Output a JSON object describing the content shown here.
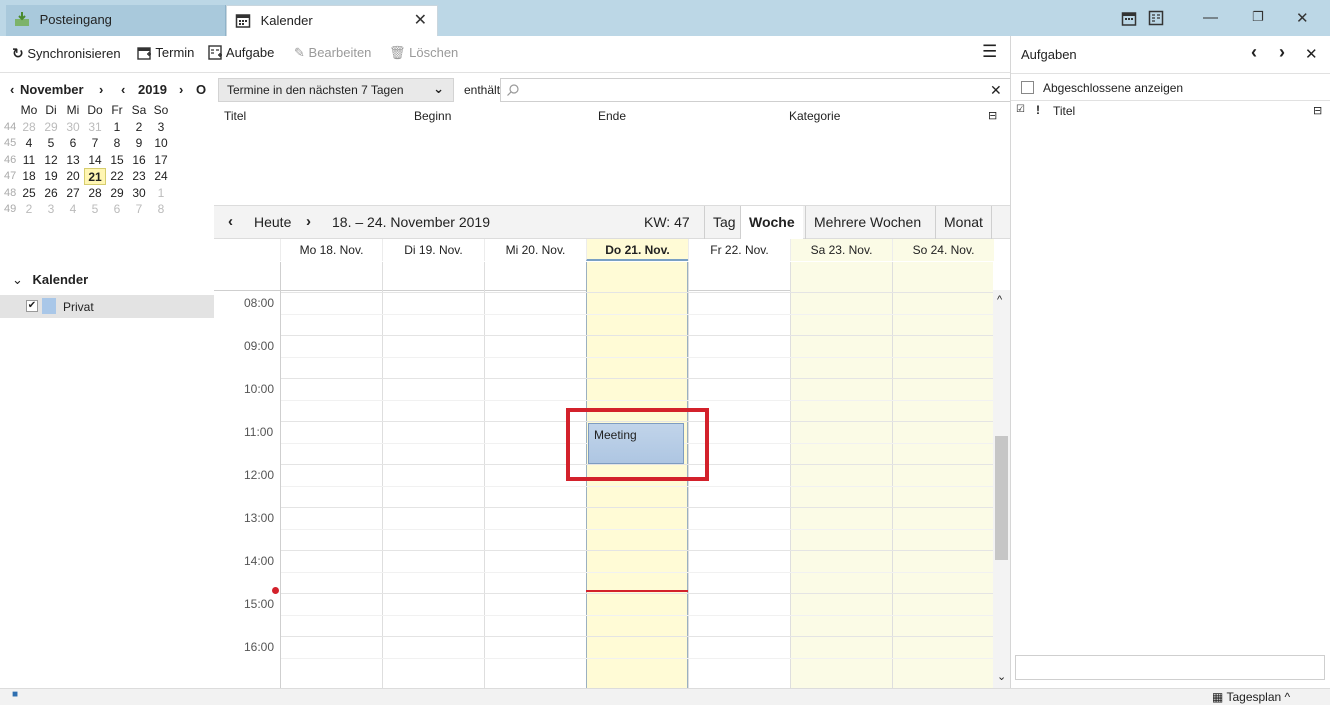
{
  "tabs": {
    "inbox": "Posteingang",
    "calendar": "Kalender"
  },
  "toolbar": {
    "sync": "Synchronisieren",
    "event": "Termin",
    "task": "Aufgabe",
    "edit": "Bearbeiten",
    "delete": "Löschen"
  },
  "minical": {
    "month": "November",
    "year": "2019",
    "weekdays": [
      "Mo",
      "Di",
      "Mi",
      "Do",
      "Fr",
      "Sa",
      "So"
    ],
    "weeks": [
      {
        "wk": "44",
        "days": [
          "28",
          "29",
          "30",
          "31",
          "1",
          "2",
          "3"
        ]
      },
      {
        "wk": "45",
        "days": [
          "4",
          "5",
          "6",
          "7",
          "8",
          "9",
          "10"
        ]
      },
      {
        "wk": "46",
        "days": [
          "11",
          "12",
          "13",
          "14",
          "15",
          "16",
          "17"
        ]
      },
      {
        "wk": "47",
        "days": [
          "18",
          "19",
          "20",
          "21",
          "22",
          "23",
          "24"
        ]
      },
      {
        "wk": "48",
        "days": [
          "25",
          "26",
          "27",
          "28",
          "29",
          "30",
          "1"
        ]
      },
      {
        "wk": "49",
        "days": [
          "2",
          "3",
          "4",
          "5",
          "6",
          "7",
          "8"
        ]
      }
    ]
  },
  "calendars": {
    "header": "Kalender",
    "items": [
      {
        "name": "Privat"
      }
    ]
  },
  "filter": {
    "select": "Termine in den nächsten 7 Tagen",
    "label": "enthält",
    "query": ""
  },
  "list_columns": [
    "Titel",
    "Beginn",
    "Ende",
    "Kategorie"
  ],
  "nav": {
    "today": "Heute",
    "range": "18. – 24. November 2019",
    "week": "KW: 47",
    "views": [
      "Tag",
      "Woche",
      "Mehrere Wochen",
      "Monat"
    ]
  },
  "days": [
    "Mo 18. Nov.",
    "Di 19. Nov.",
    "Mi 20. Nov.",
    "Do 21. Nov.",
    "Fr 22. Nov.",
    "Sa 23. Nov.",
    "So 24. Nov."
  ],
  "hours": [
    "08:00",
    "09:00",
    "10:00",
    "11:00",
    "12:00",
    "13:00",
    "14:00",
    "15:00",
    "16:00"
  ],
  "event": {
    "title": "Meeting"
  },
  "tasks": {
    "title": "Aufgaben",
    "show_completed": "Abgeschlossene anzeigen",
    "column_title": "Titel",
    "priority_mark": "!"
  },
  "statusbar": {
    "today_pane": "Tagesplan"
  },
  "colors": {
    "today_column": "#fffbd6",
    "weekend": "#fbfbe6",
    "event": "#aec6e2",
    "highlight": "#d3212b"
  }
}
